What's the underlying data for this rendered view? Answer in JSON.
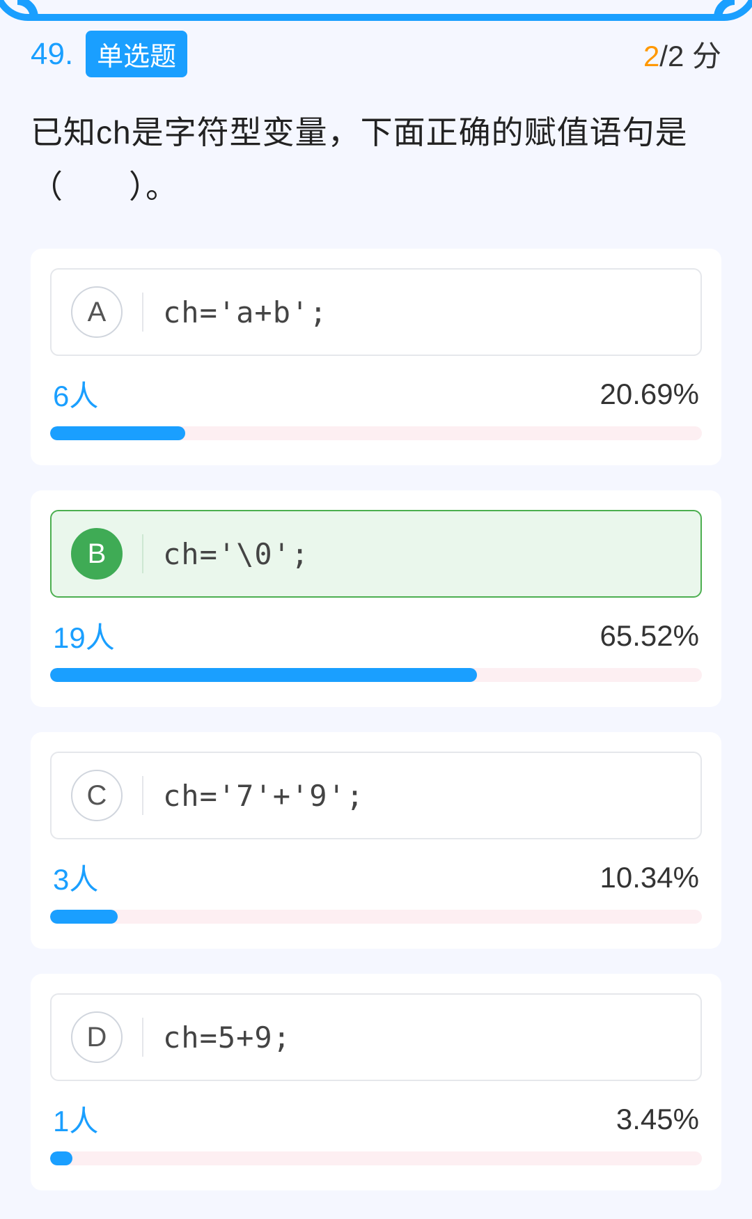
{
  "header": {
    "number": "49.",
    "tag": "单选题",
    "score_earned": "2",
    "score_total": "/2 分"
  },
  "question": "已知ch是字符型变量，下面正确的赋值语句是（　　）。",
  "options": [
    {
      "letter": "A",
      "text": "ch='a+b';",
      "people": "6人",
      "percent": "20.69%",
      "width": 20.69,
      "correct": false
    },
    {
      "letter": "B",
      "text": "ch='\\0';",
      "people": "19人",
      "percent": "65.52%",
      "width": 65.52,
      "correct": true
    },
    {
      "letter": "C",
      "text": "ch='7'+'9';",
      "people": "3人",
      "percent": "10.34%",
      "width": 10.34,
      "correct": false
    },
    {
      "letter": "D",
      "text": "ch=5+9;",
      "people": "1人",
      "percent": "3.45%",
      "width": 3.45,
      "correct": false
    }
  ]
}
